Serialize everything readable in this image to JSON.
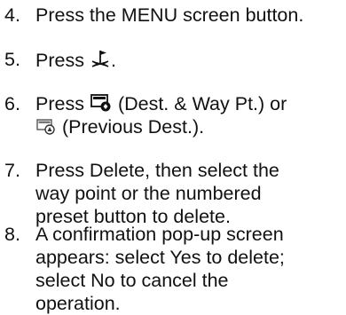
{
  "steps": [
    {
      "number": "4.",
      "lines": [
        "Press the MENU screen button."
      ]
    },
    {
      "number": "5.",
      "prefix": "Press",
      "icon": "navigation-destination-flag-icon",
      "suffix": "."
    },
    {
      "number": "6.",
      "prefix": "Press",
      "icon": "dest-and-waypoint-icon",
      "mid": "(Dest. & Way Pt.) or",
      "icon2": "previous-destination-icon",
      "suffix": "(Previous Dest.)."
    },
    {
      "number": "7.",
      "lines": [
        "Press Delete, then select the",
        "way point or the numbered",
        "preset button to delete."
      ]
    },
    {
      "number": "8.",
      "lines": [
        "A confirmation pop-up screen",
        "appears: select Yes to delete;",
        "select No to cancel the",
        "operation."
      ]
    }
  ]
}
